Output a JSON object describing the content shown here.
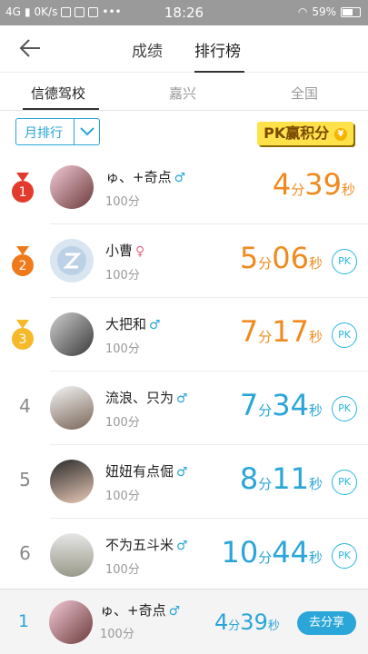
{
  "status_bar": {
    "network": "4G",
    "speed": "0K/s",
    "time": "18:26",
    "battery": "59%"
  },
  "nav": {
    "tabs": [
      "成绩",
      "排行榜"
    ],
    "active_tab": "排行榜"
  },
  "subtabs": [
    "信德驾校",
    "嘉兴",
    "全国"
  ],
  "filter": {
    "label": "月排行"
  },
  "pk_banner": "PK赢积分",
  "pk_label": "PK",
  "colors": {
    "gold": "#f2b61d",
    "silver": "#f07a1a",
    "bronze": "#e6a829",
    "first_time": "#f08a1f",
    "blue_time": "#29a5d8",
    "red_medal": "#e23b2e",
    "orange_medal": "#f07a1a",
    "yellow_medal": "#f5b92a"
  },
  "ranking": [
    {
      "rank": "1",
      "name": "ゅ、+奇点",
      "gender": "♂",
      "score": "100分",
      "min": "4",
      "min_unit": "分",
      "sec": "39",
      "sec_unit": "秒",
      "medal": "red",
      "pk": false
    },
    {
      "rank": "2",
      "name": "小曹",
      "gender": "♀",
      "score": "100分",
      "min": "5",
      "min_unit": "分",
      "sec": "06",
      "sec_unit": "秒",
      "medal": "orange",
      "pk": true
    },
    {
      "rank": "3",
      "name": "大把和",
      "gender": "♂",
      "score": "100分",
      "min": "7",
      "min_unit": "分",
      "sec": "17",
      "sec_unit": "秒",
      "medal": "yellow",
      "pk": true
    },
    {
      "rank": "4",
      "name": "流浪、只为",
      "gender": "♂",
      "score": "100分",
      "min": "7",
      "min_unit": "分",
      "sec": "34",
      "sec_unit": "秒",
      "medal": "",
      "pk": true
    },
    {
      "rank": "5",
      "name": "妞妞有点倔",
      "gender": "♂",
      "score": "100分",
      "min": "8",
      "min_unit": "分",
      "sec": "11",
      "sec_unit": "秒",
      "medal": "",
      "pk": true
    },
    {
      "rank": "6",
      "name": "不为五斗米",
      "gender": "♂",
      "score": "100分",
      "min": "10",
      "min_unit": "分",
      "sec": "44",
      "sec_unit": "秒",
      "medal": "",
      "pk": true
    }
  ],
  "my_entry": {
    "rank": "1",
    "name": "ゅ、+奇点",
    "gender": "♂",
    "score": "100分",
    "min": "4",
    "min_unit": "分",
    "sec": "39",
    "sec_unit": "秒",
    "share_label": "去分享"
  }
}
